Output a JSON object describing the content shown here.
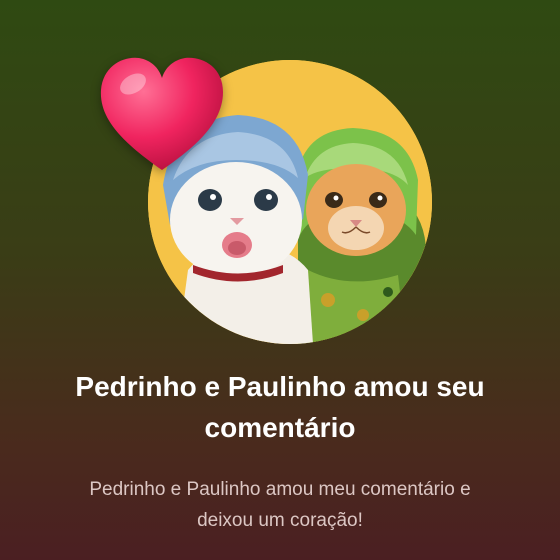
{
  "notification": {
    "title": "Pedrinho e Paulinho amou seu comentário",
    "message": "Pedrinho e Paulinho amou meu comentário e deixou um coração!",
    "reaction_icon": "heart-icon",
    "avatar_icon": "cats-avatar"
  },
  "colors": {
    "background_top": "#2f4a12",
    "background_bottom": "#4b1f22",
    "avatar_ring": "#f5c347",
    "heart": "#f0245f",
    "title_text": "#ffffff",
    "message_text": "#dcc7c4"
  }
}
